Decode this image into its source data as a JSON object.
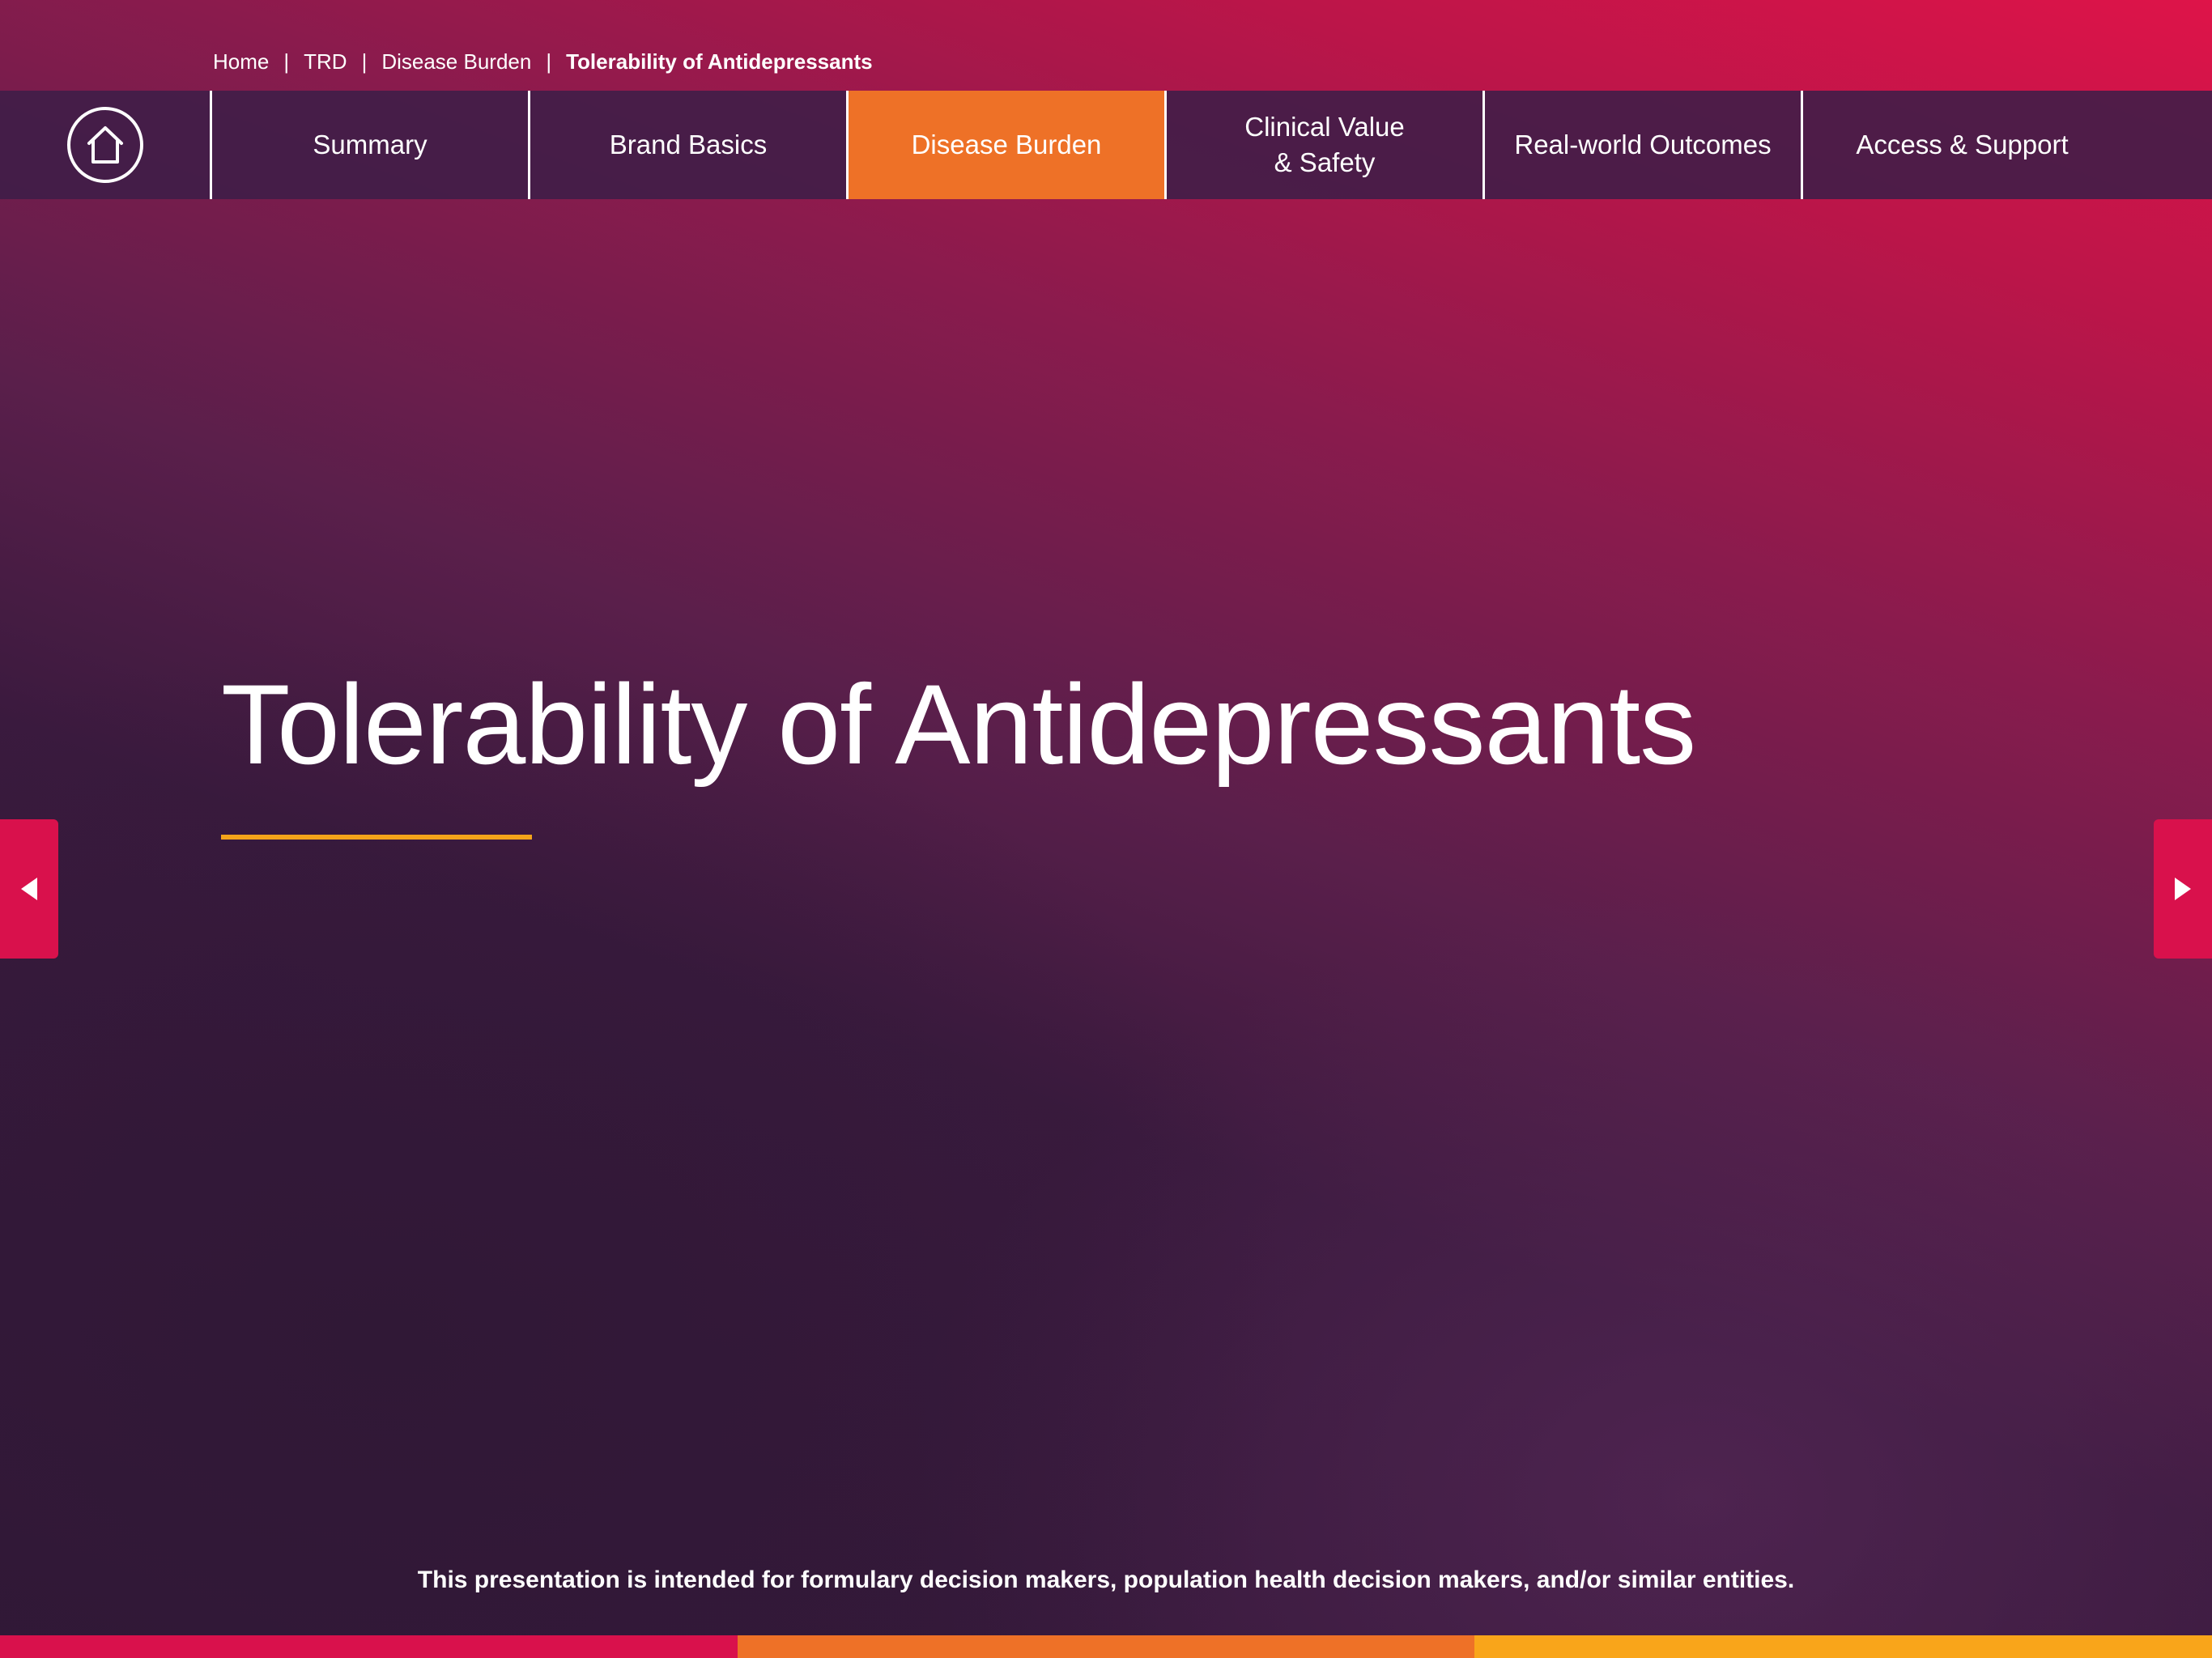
{
  "breadcrumb": {
    "items": [
      "Home",
      "TRD",
      "Disease Burden"
    ],
    "separator": "|",
    "current": "Tolerability of Antidepressants"
  },
  "nav": {
    "home_icon": "home-icon",
    "items": [
      {
        "label": "Summary",
        "active": false
      },
      {
        "label": "Brand Basics",
        "active": false
      },
      {
        "label": "Disease Burden",
        "active": true
      },
      {
        "label": "Clinical Value\n& Safety",
        "active": false
      },
      {
        "label": "Real-world Outcomes",
        "active": false
      },
      {
        "label": "Access & Support",
        "active": false
      }
    ]
  },
  "main": {
    "title": "Tolerability of Antidepressants"
  },
  "arrows": {
    "prev_icon": "triangle-left-icon",
    "next_icon": "triangle-right-icon"
  },
  "footer": {
    "disclaimer": "This presentation is intended for formulary decision makers, population health decision makers, and/or similar entities."
  },
  "colors": {
    "accent_orange": "#ee7127",
    "accent_red": "#d9114c",
    "underline_gold": "#f4a41a",
    "bottom_bar": [
      "#d9114c",
      "#ee7127",
      "#f9a51a"
    ]
  }
}
